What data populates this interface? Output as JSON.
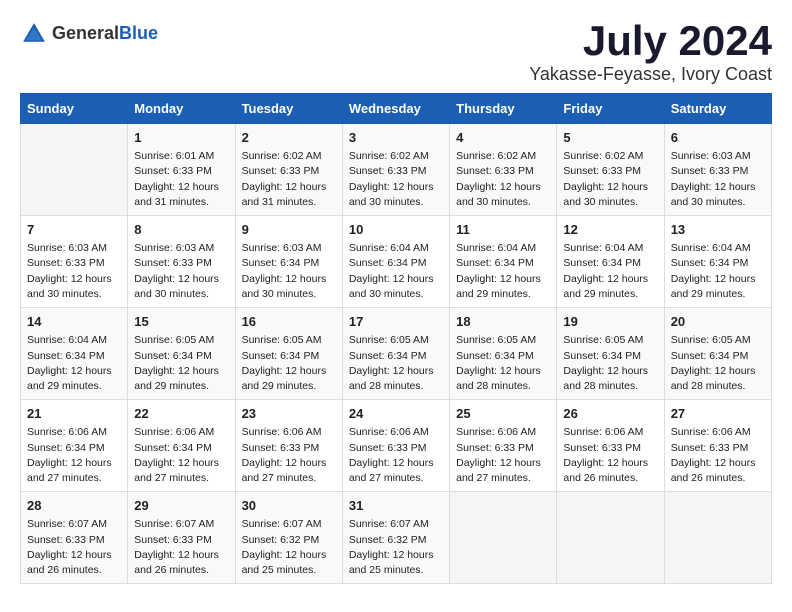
{
  "header": {
    "logo_general": "General",
    "logo_blue": "Blue",
    "month_title": "July 2024",
    "location": "Yakasse-Feyasse, Ivory Coast"
  },
  "days_of_week": [
    "Sunday",
    "Monday",
    "Tuesday",
    "Wednesday",
    "Thursday",
    "Friday",
    "Saturday"
  ],
  "weeks": [
    [
      {
        "day": "",
        "info": ""
      },
      {
        "day": "1",
        "info": "Sunrise: 6:01 AM\nSunset: 6:33 PM\nDaylight: 12 hours\nand 31 minutes."
      },
      {
        "day": "2",
        "info": "Sunrise: 6:02 AM\nSunset: 6:33 PM\nDaylight: 12 hours\nand 31 minutes."
      },
      {
        "day": "3",
        "info": "Sunrise: 6:02 AM\nSunset: 6:33 PM\nDaylight: 12 hours\nand 30 minutes."
      },
      {
        "day": "4",
        "info": "Sunrise: 6:02 AM\nSunset: 6:33 PM\nDaylight: 12 hours\nand 30 minutes."
      },
      {
        "day": "5",
        "info": "Sunrise: 6:02 AM\nSunset: 6:33 PM\nDaylight: 12 hours\nand 30 minutes."
      },
      {
        "day": "6",
        "info": "Sunrise: 6:03 AM\nSunset: 6:33 PM\nDaylight: 12 hours\nand 30 minutes."
      }
    ],
    [
      {
        "day": "7",
        "info": "Sunrise: 6:03 AM\nSunset: 6:33 PM\nDaylight: 12 hours\nand 30 minutes."
      },
      {
        "day": "8",
        "info": "Sunrise: 6:03 AM\nSunset: 6:33 PM\nDaylight: 12 hours\nand 30 minutes."
      },
      {
        "day": "9",
        "info": "Sunrise: 6:03 AM\nSunset: 6:34 PM\nDaylight: 12 hours\nand 30 minutes."
      },
      {
        "day": "10",
        "info": "Sunrise: 6:04 AM\nSunset: 6:34 PM\nDaylight: 12 hours\nand 30 minutes."
      },
      {
        "day": "11",
        "info": "Sunrise: 6:04 AM\nSunset: 6:34 PM\nDaylight: 12 hours\nand 29 minutes."
      },
      {
        "day": "12",
        "info": "Sunrise: 6:04 AM\nSunset: 6:34 PM\nDaylight: 12 hours\nand 29 minutes."
      },
      {
        "day": "13",
        "info": "Sunrise: 6:04 AM\nSunset: 6:34 PM\nDaylight: 12 hours\nand 29 minutes."
      }
    ],
    [
      {
        "day": "14",
        "info": "Sunrise: 6:04 AM\nSunset: 6:34 PM\nDaylight: 12 hours\nand 29 minutes."
      },
      {
        "day": "15",
        "info": "Sunrise: 6:05 AM\nSunset: 6:34 PM\nDaylight: 12 hours\nand 29 minutes."
      },
      {
        "day": "16",
        "info": "Sunrise: 6:05 AM\nSunset: 6:34 PM\nDaylight: 12 hours\nand 29 minutes."
      },
      {
        "day": "17",
        "info": "Sunrise: 6:05 AM\nSunset: 6:34 PM\nDaylight: 12 hours\nand 28 minutes."
      },
      {
        "day": "18",
        "info": "Sunrise: 6:05 AM\nSunset: 6:34 PM\nDaylight: 12 hours\nand 28 minutes."
      },
      {
        "day": "19",
        "info": "Sunrise: 6:05 AM\nSunset: 6:34 PM\nDaylight: 12 hours\nand 28 minutes."
      },
      {
        "day": "20",
        "info": "Sunrise: 6:05 AM\nSunset: 6:34 PM\nDaylight: 12 hours\nand 28 minutes."
      }
    ],
    [
      {
        "day": "21",
        "info": "Sunrise: 6:06 AM\nSunset: 6:34 PM\nDaylight: 12 hours\nand 27 minutes."
      },
      {
        "day": "22",
        "info": "Sunrise: 6:06 AM\nSunset: 6:34 PM\nDaylight: 12 hours\nand 27 minutes."
      },
      {
        "day": "23",
        "info": "Sunrise: 6:06 AM\nSunset: 6:33 PM\nDaylight: 12 hours\nand 27 minutes."
      },
      {
        "day": "24",
        "info": "Sunrise: 6:06 AM\nSunset: 6:33 PM\nDaylight: 12 hours\nand 27 minutes."
      },
      {
        "day": "25",
        "info": "Sunrise: 6:06 AM\nSunset: 6:33 PM\nDaylight: 12 hours\nand 27 minutes."
      },
      {
        "day": "26",
        "info": "Sunrise: 6:06 AM\nSunset: 6:33 PM\nDaylight: 12 hours\nand 26 minutes."
      },
      {
        "day": "27",
        "info": "Sunrise: 6:06 AM\nSunset: 6:33 PM\nDaylight: 12 hours\nand 26 minutes."
      }
    ],
    [
      {
        "day": "28",
        "info": "Sunrise: 6:07 AM\nSunset: 6:33 PM\nDaylight: 12 hours\nand 26 minutes."
      },
      {
        "day": "29",
        "info": "Sunrise: 6:07 AM\nSunset: 6:33 PM\nDaylight: 12 hours\nand 26 minutes."
      },
      {
        "day": "30",
        "info": "Sunrise: 6:07 AM\nSunset: 6:32 PM\nDaylight: 12 hours\nand 25 minutes."
      },
      {
        "day": "31",
        "info": "Sunrise: 6:07 AM\nSunset: 6:32 PM\nDaylight: 12 hours\nand 25 minutes."
      },
      {
        "day": "",
        "info": ""
      },
      {
        "day": "",
        "info": ""
      },
      {
        "day": "",
        "info": ""
      }
    ]
  ]
}
